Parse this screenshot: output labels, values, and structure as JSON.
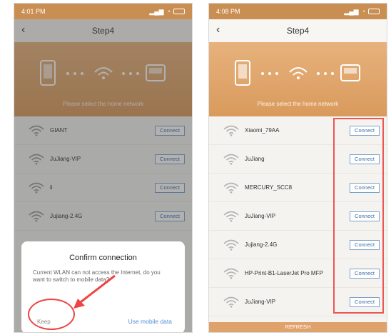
{
  "left": {
    "status_time": "4:01 PM",
    "title": "Step4",
    "banner_text": "Please select the home network",
    "networks": [
      {
        "ssid": "GIANT",
        "connect": "Connect"
      },
      {
        "ssid": "JuJiang-VIP",
        "connect": "Connect"
      },
      {
        "ssid": "ii",
        "connect": "Connect"
      },
      {
        "ssid": "Jujiang-2.4G",
        "connect": "Connect"
      }
    ],
    "dialog": {
      "title": "Confirm connection",
      "message": "Current WLAN can not access the Internet, do you want to switch to mobile data?",
      "keep": "Keep",
      "use_mobile": "Use mobile data"
    }
  },
  "right": {
    "status_time": "4:08 PM",
    "title": "Step4",
    "banner_text": "Please select the home network",
    "networks": [
      {
        "ssid": "Xiaomi_79AA",
        "connect": "Connect"
      },
      {
        "ssid": "JuJiang",
        "connect": "Connect"
      },
      {
        "ssid": "MERCURY_SCC8",
        "connect": "Connect"
      },
      {
        "ssid": "JuJiang-VIP",
        "connect": "Connect"
      },
      {
        "ssid": "Jujiang-2.4G",
        "connect": "Connect"
      },
      {
        "ssid": "HP-Print-B1-LaserJet Pro MFP",
        "connect": "Connect"
      },
      {
        "ssid": "JuJiang-VIP",
        "connect": "Connect"
      }
    ],
    "refresh": "REFRESH"
  },
  "colors": {
    "accent": "#d99a5c",
    "link": "#4f8fd6",
    "annotation": "#e44"
  }
}
